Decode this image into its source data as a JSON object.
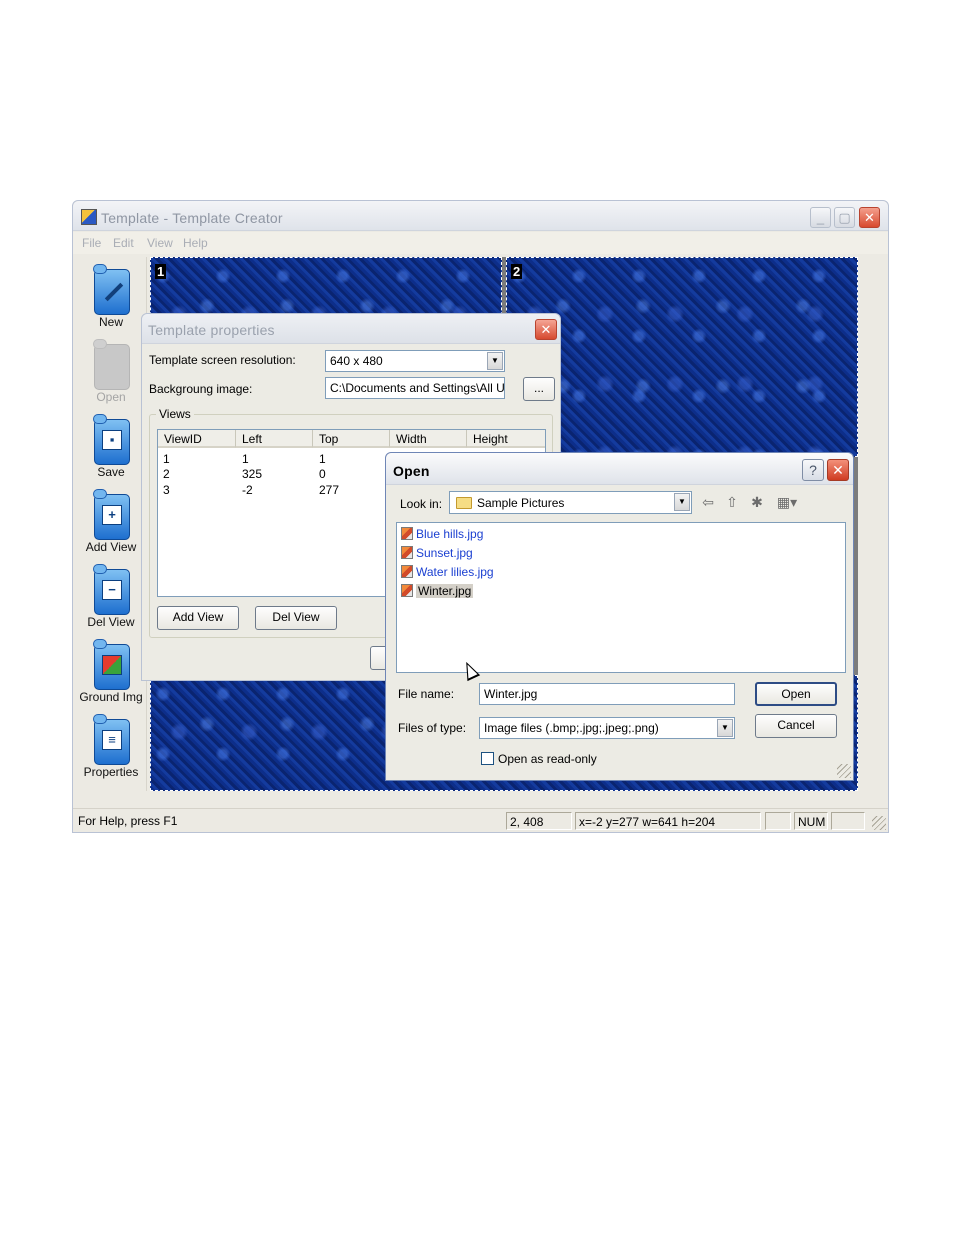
{
  "app": {
    "title": "Template - Template Creator",
    "menu": [
      "File",
      "Edit",
      "View",
      "Help"
    ],
    "toolbar": [
      {
        "label": "New",
        "icon": "new-pen-icon",
        "enabled": true
      },
      {
        "label": "Open",
        "icon": "open-icon",
        "enabled": false
      },
      {
        "label": "Save",
        "icon": "save-disk-icon",
        "enabled": true
      },
      {
        "label": "Add View",
        "icon": "add-view-icon",
        "enabled": true
      },
      {
        "label": "Del View",
        "icon": "del-view-icon",
        "enabled": true
      },
      {
        "label": "Ground Img",
        "icon": "ground-image-icon",
        "enabled": true
      },
      {
        "label": "Properties",
        "icon": "properties-icon",
        "enabled": true
      }
    ],
    "views": [
      "1",
      "2"
    ],
    "status": {
      "help": "For Help, press F1",
      "cursor": "2, 408",
      "selection": "x=-2 y=277 w=641 h=204",
      "num": "NUM"
    }
  },
  "template_properties": {
    "title": "Template properties",
    "resolution_label": "Template screen resolution:",
    "resolution_value": "640 x 480",
    "background_label": "Backgroung image:",
    "background_value": "C:\\Documents and Settings\\All U",
    "browse_label": "...",
    "views_group": "Views",
    "columns": [
      "ViewID",
      "Left",
      "Top",
      "Width",
      "Height"
    ],
    "rows": [
      [
        "1",
        "1",
        "1"
      ],
      [
        "2",
        "325",
        "0"
      ],
      [
        "3",
        "-2",
        "277"
      ]
    ],
    "add_view_label": "Add View",
    "del_view_label": "Del View"
  },
  "open_dialog": {
    "title": "Open",
    "help_label": "?",
    "look_in_label": "Look in:",
    "look_in_value": "Sample Pictures",
    "files": [
      "Blue hills.jpg",
      "Sunset.jpg",
      "Water lilies.jpg",
      "Winter.jpg"
    ],
    "selected_file": "Winter.jpg",
    "file_name_label": "File name:",
    "file_name_value": "Winter.jpg",
    "files_of_type_label": "Files of type:",
    "files_of_type_value": "Image files (.bmp;.jpg;.jpeg;.png)",
    "open_label": "Open",
    "cancel_label": "Cancel",
    "read_only_label": "Open as read-only"
  }
}
